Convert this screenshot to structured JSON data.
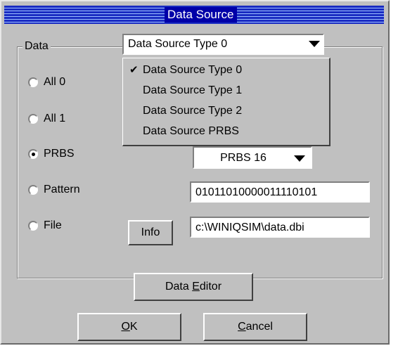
{
  "window": {
    "title": "Data Source"
  },
  "data_group": {
    "label": "Data",
    "options": [
      "All 0",
      "All 1",
      "PRBS",
      "Pattern",
      "File"
    ],
    "selected": "PRBS"
  },
  "source_type": {
    "value": "Data Source Type 0",
    "items": [
      "Data Source Type 0",
      "Data Source Type 1",
      "Data Source Type 2",
      "Data Source PRBS"
    ],
    "checked": "Data Source Type 0"
  },
  "prbs": {
    "value": "PRBS 16"
  },
  "pattern": {
    "value": "01011010000011110101"
  },
  "file": {
    "path": "c:\\WINIQSIM\\data.dbi"
  },
  "buttons": {
    "info": "Info",
    "data_editor": {
      "prefix": "Data ",
      "accel": "E",
      "suffix": "ditor"
    },
    "ok": {
      "accel": "O",
      "suffix": "K"
    },
    "cancel": {
      "accel": "C",
      "suffix": "ancel"
    }
  },
  "colors": {
    "face": "#c0c0c0",
    "title_bar": "#1a2cc2",
    "title_highlight": "#0000a8"
  }
}
